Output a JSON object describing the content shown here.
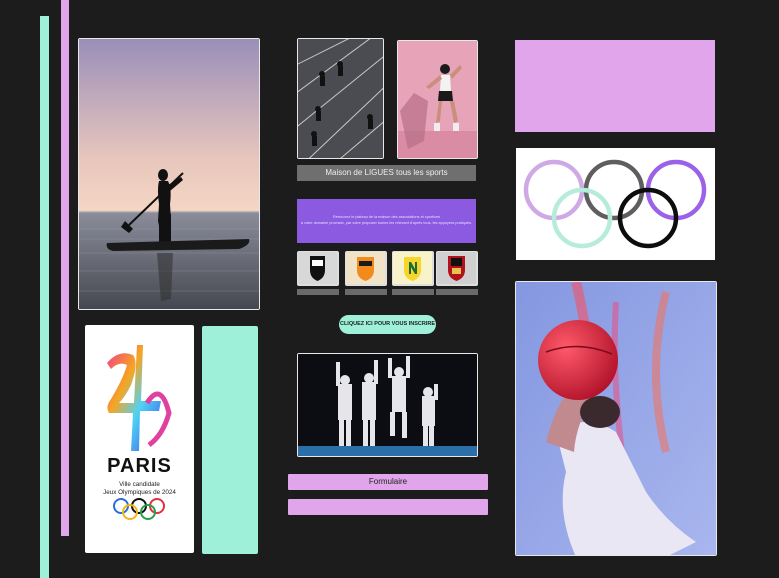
{
  "league": {
    "title": "Maison de LIGUES tous les sports"
  },
  "info_box": {
    "line1": "Retrouvez le plateau de la maison des associations et sportives",
    "line2": "à votre domaine prochain, par votre proposer toutes les relevant d’après tous, les appuyera pratiqués."
  },
  "cta": {
    "label": "CLIQUEZ ICI POUR VOUS INSCRIRE"
  },
  "paris": {
    "title": "PARIS",
    "subtitle1": "Ville candidate",
    "subtitle2": "Jeux Olympiques de 2024"
  },
  "form": {
    "title": "Formulaire"
  },
  "clubs": [
    "angers-crest",
    "lorient-crest",
    "nantes-crest",
    "nice-crest"
  ],
  "colors": {
    "background": "#1c1c1c",
    "mint": "#9ef0d8",
    "pink": "#e0a5ea",
    "purple": "#8b5ae0",
    "grey_bar": "#6f6f6f"
  }
}
